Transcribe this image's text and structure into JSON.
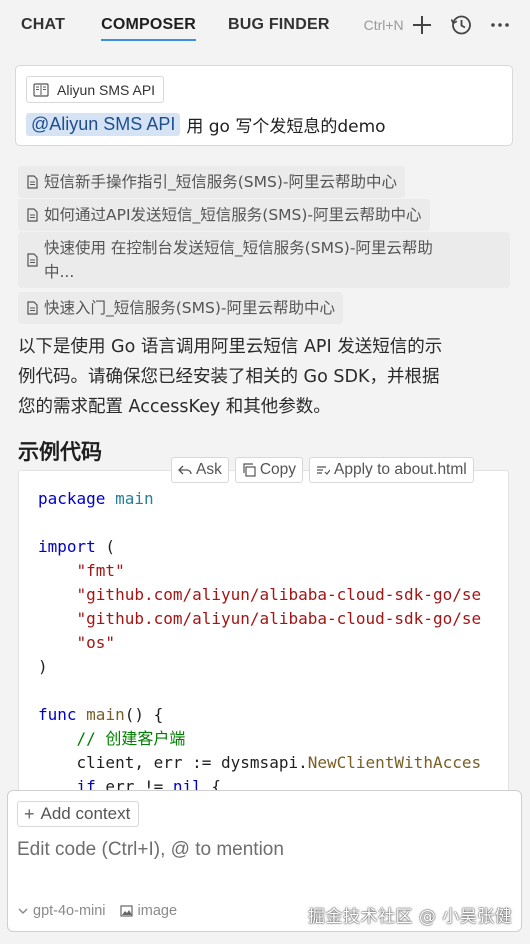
{
  "tabs": [
    {
      "label": "CHAT",
      "active": false
    },
    {
      "label": "COMPOSER",
      "active": true
    },
    {
      "label": "BUG FINDER",
      "active": false
    }
  ],
  "toolbar": {
    "shortcut": "Ctrl+N",
    "icons": [
      "plus-icon",
      "history-icon",
      "more-icon"
    ]
  },
  "user_message": {
    "context_chip": "Aliyun SMS API",
    "mention": "@Aliyun SMS API",
    "text": "用 go 写个发短息的demo"
  },
  "sources": [
    {
      "title": "短信新手操作指引_短信服务(SMS)-阿里云帮助中心"
    },
    {
      "title": "如何通过API发送短信_短信服务(SMS)-阿里云帮助中心"
    },
    {
      "title": "快速使用 在控制台发送短信_短信服务(SMS)-阿里云帮助中...",
      "line1": "快速使用 在控制台发送短信_短信服务(SMS)-阿里云帮助",
      "line2": "中..."
    },
    {
      "title": "快速入门_短信服务(SMS)-阿里云帮助中心"
    }
  ],
  "answer": {
    "intro": "以下是使用 Go 语言调用阿里云短信 API 发送短信的示例代码。请确保您已经安装了相关的 Go SDK，并根据您的需求配置 AccessKey 和其他参数。",
    "intro_line1": "以下是使用 Go 语言调用阿里云短信 API 发送短信的示",
    "intro_line2": "例代码。请确保您已经安装了相关的 Go SDK，并根据",
    "intro_line3": "您的需求配置 AccessKey 和其他参数。",
    "heading": "示例代码"
  },
  "code_actions": {
    "ask": "Ask",
    "copy": "Copy",
    "apply": "Apply to about.html"
  },
  "code": {
    "language": "go",
    "lines": [
      "package main",
      "",
      "import (",
      "    \"fmt\"",
      "    \"github.com/aliyun/alibaba-cloud-sdk-go/se",
      "    \"github.com/aliyun/alibaba-cloud-sdk-go/se",
      "    \"os\"",
      ")",
      "",
      "func main() {",
      "    // 创建客户端",
      "    client, err := dysmsapi.NewClientWithAcces",
      "    if err != nil {"
    ]
  },
  "composer": {
    "add_context": "Add context",
    "placeholder": "Edit code (Ctrl+I), @ to mention",
    "model": "gpt-4o-mini",
    "image": "image"
  },
  "watermark": "掘金技术社区 @ 小吴张健"
}
